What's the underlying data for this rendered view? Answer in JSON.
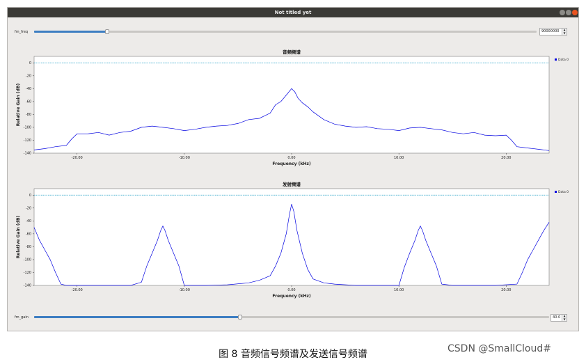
{
  "window": {
    "title": "Not titled yet"
  },
  "controls": {
    "fm_freq": {
      "label": "fm_freq",
      "value": "90000000",
      "fraction": 0.145
    },
    "fm_gain": {
      "label": "fm_gain",
      "value": "40.0",
      "fraction": 0.4
    }
  },
  "colors": {
    "trace": "#0000e0",
    "reference": "#2aa3c8",
    "slider_fill": "#3d7ec2",
    "legend_marker": "#0000e0"
  },
  "chart_data": [
    {
      "type": "line",
      "title": "音频频谱",
      "xlabel": "Frequency (kHz)",
      "ylabel": "Relative Gain (dB)",
      "xlim": [
        -24,
        24
      ],
      "ylim": [
        -140,
        10
      ],
      "xticks": [
        -20,
        -10,
        0,
        10,
        20
      ],
      "xtick_labels": [
        "-20.00",
        "-10.00",
        "0.00",
        "10.00",
        "20.00"
      ],
      "yticks": [
        0,
        -20,
        -40,
        -60,
        -80,
        -100,
        -120,
        -140
      ],
      "ytick_labels": [
        "0",
        "-20",
        "-40",
        "-60",
        "-80",
        "-100",
        "-120",
        "-140"
      ],
      "reference_line": 0,
      "legend": [
        "Data 0"
      ],
      "series": [
        {
          "name": "Data 0",
          "x": [
            -24,
            -23,
            -22,
            -21,
            -20.5,
            -20,
            -19,
            -18,
            -17,
            -16,
            -15,
            -14,
            -13,
            -12,
            -11,
            -10,
            -9,
            -8,
            -7,
            -6,
            -5,
            -4,
            -3,
            -2,
            -1.5,
            -1,
            -0.5,
            -0.2,
            0,
            0.3,
            0.6,
            1,
            1.5,
            2,
            3,
            4,
            5,
            6,
            7,
            8,
            9,
            10,
            11,
            12,
            13,
            14,
            15,
            16,
            17,
            18,
            19,
            20,
            20.5,
            21,
            22,
            23,
            24
          ],
          "y": [
            -135,
            -133,
            -130,
            -128,
            -118,
            -110,
            -110,
            -108,
            -112,
            -108,
            -106,
            -100,
            -98,
            -100,
            -102,
            -105,
            -103,
            -100,
            -98,
            -97,
            -94,
            -88,
            -86,
            -78,
            -65,
            -60,
            -50,
            -44,
            -40,
            -45,
            -55,
            -62,
            -68,
            -76,
            -88,
            -95,
            -98,
            -100,
            -99,
            -102,
            -103,
            -105,
            -101,
            -100,
            -102,
            -104,
            -108,
            -110,
            -108,
            -112,
            -113,
            -112,
            -120,
            -130,
            -132,
            -134,
            -136
          ]
        }
      ]
    },
    {
      "type": "line",
      "title": "发射频谱",
      "xlabel": "Frequency (kHz)",
      "ylabel": "Relative Gain (dB)",
      "xlim": [
        -24,
        24
      ],
      "ylim": [
        -140,
        10
      ],
      "xticks": [
        -20,
        -10,
        0,
        10,
        20
      ],
      "xtick_labels": [
        "-20.00",
        "-10.00",
        "0.00",
        "10.00",
        "20.00"
      ],
      "yticks": [
        0,
        -20,
        -40,
        -60,
        -80,
        -100,
        -120,
        -140
      ],
      "ytick_labels": [
        "0",
        "-20",
        "-40",
        "-60",
        "-80",
        "-100",
        "-120",
        "-140"
      ],
      "reference_line": 0,
      "legend": [
        "Data 0"
      ],
      "series": [
        {
          "name": "Data 0",
          "x": [
            -24,
            -23.5,
            -23,
            -22.5,
            -22,
            -21.5,
            -21,
            -16,
            -15,
            -14,
            -13.5,
            -13,
            -12.5,
            -12.2,
            -12,
            -11.8,
            -11.5,
            -11,
            -10.5,
            -10,
            -8,
            -6,
            -4,
            -3,
            -2,
            -1.5,
            -1,
            -0.5,
            -0.2,
            0,
            0.2,
            0.5,
            1,
            1.5,
            2,
            3,
            4,
            6,
            8,
            10,
            10.5,
            11,
            11.5,
            11.8,
            12,
            12.2,
            12.5,
            13,
            13.5,
            14,
            15,
            19,
            21,
            21.5,
            22,
            22.5,
            23,
            23.5,
            24
          ],
          "y": [
            -50,
            -70,
            -85,
            -100,
            -120,
            -138,
            -140,
            -140,
            -140,
            -135,
            -110,
            -90,
            -70,
            -55,
            -48,
            -55,
            -70,
            -90,
            -110,
            -140,
            -140,
            -139,
            -136,
            -132,
            -125,
            -110,
            -90,
            -60,
            -30,
            -14,
            -25,
            -55,
            -90,
            -115,
            -130,
            -136,
            -138,
            -140,
            -140,
            -140,
            -112,
            -90,
            -70,
            -55,
            -48,
            -55,
            -70,
            -90,
            -110,
            -138,
            -140,
            -140,
            -138,
            -120,
            -100,
            -85,
            -70,
            -55,
            -42
          ]
        }
      ]
    }
  ],
  "caption": "图 8  音频信号频谱及发送信号频谱",
  "watermark": "CSDN @SmallCloud#"
}
